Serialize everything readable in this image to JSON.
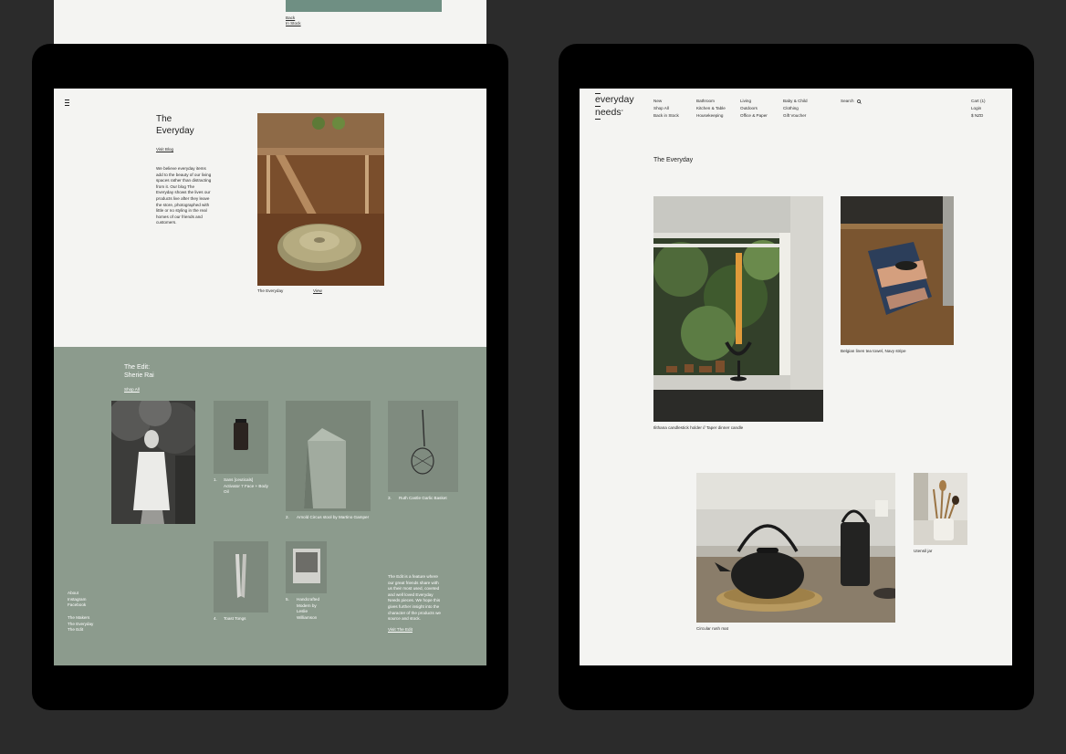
{
  "top_page": {
    "link_back": "Back",
    "link_in_stock": "In Stock"
  },
  "left": {
    "blog_title_line1": "The",
    "blog_title_line2": "Everyday",
    "visit_blog": "Visit Blog",
    "blog_paragraph": [
      "We believe everyday items",
      "add to the beauty of our living",
      "spaces rather than distracting",
      "from it. Our blog The",
      "Everyday shows the lives our",
      "products live after they leave",
      "the store, photographed with",
      "little or no styling in the real",
      "homes of our friends and",
      "customers."
    ],
    "feature_caption": "The Everyday",
    "feature_view": "View",
    "edit_title_line1": "The Edit:",
    "edit_title_line2": "Sherie Rai",
    "shop_all": "Shop All",
    "products": [
      {
        "num": "1.",
        "name_lines": [
          "Sans [ceuticals]",
          "Activator 7 Face + Body",
          "Oil"
        ]
      },
      {
        "num": "2.",
        "name_lines": [
          "Arnold Circus stool by Martino Gamper"
        ]
      },
      {
        "num": "3.",
        "name_lines": [
          "Ruth Castle Garlic Basket"
        ]
      },
      {
        "num": "4.",
        "name_lines": [
          "Toast Tongs"
        ]
      },
      {
        "num": "5.",
        "name_lines": [
          "Handcrafted",
          "Modern by",
          "Leslie",
          "Williamson"
        ]
      }
    ],
    "edit_paragraph": [
      "The Edit is a feature where",
      "our great friends share with",
      "us their most used, coveted",
      "and well loved Everyday",
      "Needs pieces. We hope this",
      "gives further insight into the",
      "character of the products we",
      "source and stock."
    ],
    "visit_edit": "Visit The Edit",
    "footer_links_1": [
      "About",
      "Instagram",
      "Facebook"
    ],
    "footer_links_2": [
      "The Makers",
      "The Everyday",
      "The Edit"
    ]
  },
  "right": {
    "logo_line1": "everyday",
    "logo_line2": "needs",
    "logo_mark": "°",
    "nav_col1": [
      "New",
      "Shop All",
      "Back in Stock"
    ],
    "nav_col2": [
      "Bathroom",
      "Kitchen & Table",
      "Housekeeping"
    ],
    "nav_col3": [
      "Living",
      "Outdoors",
      "Office & Paper"
    ],
    "nav_col4": [
      "Baby & Child",
      "Clothing",
      "Gift Voucher"
    ],
    "search_label": "Search",
    "account": [
      "Cart (1)",
      "Login",
      "$ NZD"
    ],
    "page_title": "The Everyday",
    "captions": {
      "candle": "Ilithana candlestick holder // Taper dinner candle",
      "towel": "Belgian linen tea towel, Navy stripe",
      "teapot": "Circular rush mat",
      "utensil": "Utensil jar"
    }
  },
  "colors": {
    "background": "#2b2b2b",
    "screen": "#f4f4f2",
    "edit_green": "#8c9b8d",
    "accent_green": "#6f8f83"
  }
}
